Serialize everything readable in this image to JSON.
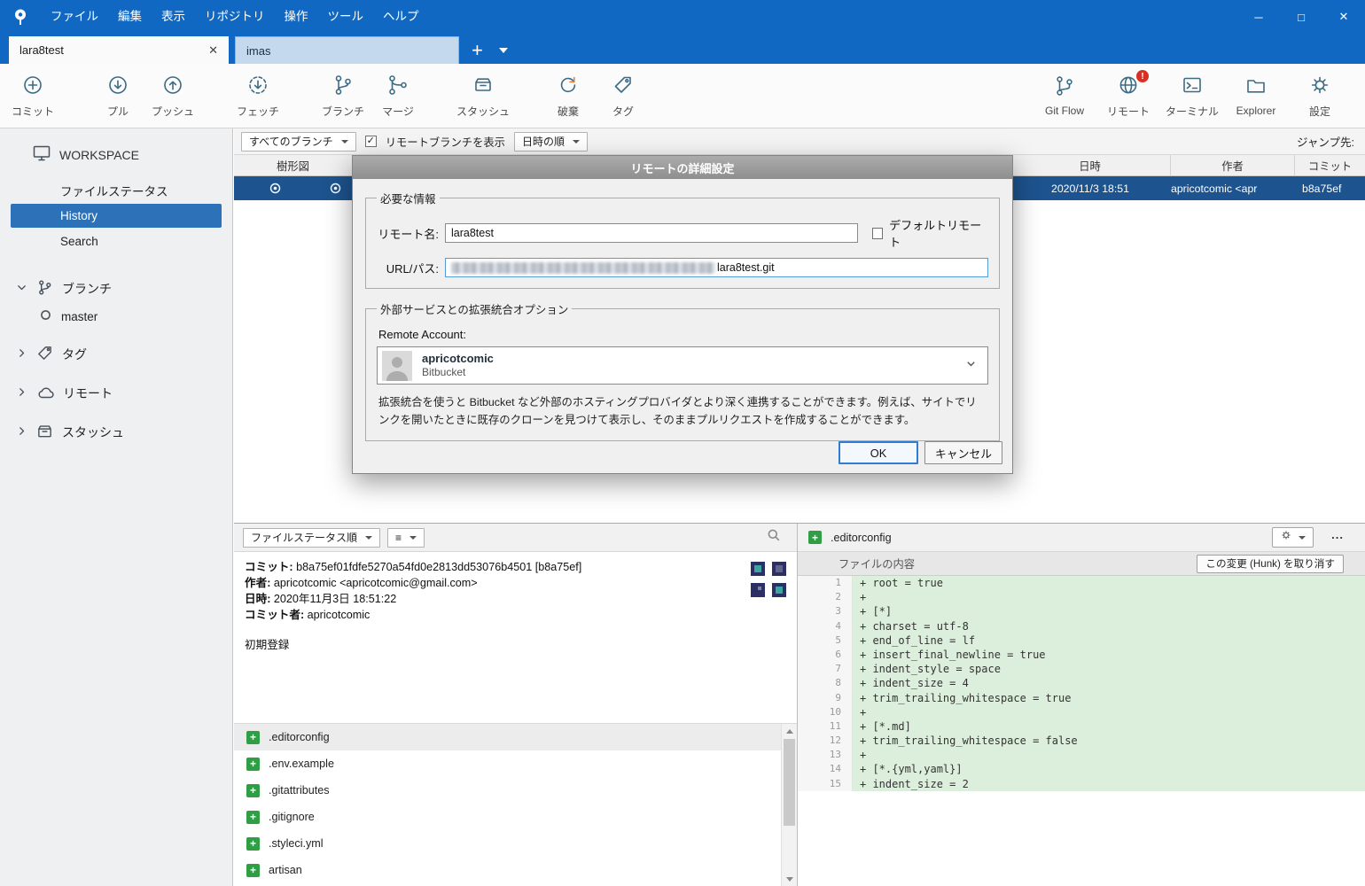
{
  "icons": {
    "minimize": "─",
    "maximize": "□",
    "close": "✕",
    "tab_close": "✕",
    "new_tab": "+",
    "check": "✓",
    "plus": "+",
    "list": "≡",
    "more": "..."
  },
  "window": {
    "menu": [
      "ファイル",
      "編集",
      "表示",
      "リポジトリ",
      "操作",
      "ツール",
      "ヘルプ"
    ],
    "tabs": [
      {
        "label": "lara8test"
      },
      {
        "label": "imas"
      }
    ]
  },
  "toolbar": {
    "left": [
      {
        "label": "コミット"
      },
      {
        "label": "プル"
      },
      {
        "label": "プッシュ"
      },
      {
        "label": "フェッチ"
      },
      {
        "label": "ブランチ"
      },
      {
        "label": "マージ"
      },
      {
        "label": "スタッシュ"
      },
      {
        "label": "破棄"
      },
      {
        "label": "タグ"
      }
    ],
    "right": [
      {
        "label": "Git Flow"
      },
      {
        "label": "リモート",
        "badge": "!"
      },
      {
        "label": "ターミナル"
      },
      {
        "label": "Explorer"
      },
      {
        "label": "設定"
      }
    ]
  },
  "sidebar": {
    "workspace": {
      "label": "WORKSPACE",
      "items": [
        "ファイルステータス",
        "History",
        "Search"
      ]
    },
    "sections": [
      {
        "label": "ブランチ",
        "items": [
          "master"
        ]
      },
      {
        "label": "タグ"
      },
      {
        "label": "リモート"
      },
      {
        "label": "スタッシュ"
      }
    ]
  },
  "history": {
    "branch_filter": "すべてのブランチ",
    "remote_checkbox": "リモートブランチを表示",
    "sort_filter": "日時の順",
    "jump_label": "ジャンプ先:",
    "columns": [
      "樹形図",
      "日時",
      "作者",
      "コミット"
    ],
    "selected": {
      "date": "2020/11/3 18:51",
      "author": "apricotcomic <apr",
      "commit": "b8a75ef"
    }
  },
  "dialog": {
    "title": "リモートの詳細設定",
    "required_group": "必要な情報",
    "remote_name_label": "リモート名:",
    "remote_name_value": "lara8test",
    "default_remote_label": "デフォルトリモート",
    "url_label": "URL/パス:",
    "url_visible_suffix": "lara8test.git",
    "integration_group": "外部サービスとの拡張統合オプション",
    "remote_account_label": "Remote Account:",
    "account_name": "apricotcomic",
    "account_service": "Bitbucket",
    "description": "拡張統合を使うと Bitbucket など外部のホスティングプロバイダとより深く連携することができます。例えば、サイトでリンクを開いたときに既存のクローンを見つけて表示し、そのままプルリクエストを作成することができます。",
    "ok_label": "OK",
    "cancel_label": "キャンセル"
  },
  "detail": {
    "sort_filter": "ファイルステータス順",
    "commit_label": "コミット:",
    "commit_value": "b8a75ef01fdfe5270a54fd0e2813dd53076b4501 [b8a75ef]",
    "author_label": "作者:",
    "author_value": "apricotcomic <apricotcomic@gmail.com>",
    "date_label": "日時:",
    "date_value": "2020年11月3日 18:51:22",
    "committer_label": "コミット者:",
    "committer_value": "apricotcomic",
    "message": "初期登録"
  },
  "files": {
    "items": [
      ".editorconfig",
      ".env.example",
      ".gitattributes",
      ".gitignore",
      ".styleci.yml",
      "artisan"
    ]
  },
  "diff": {
    "file": ".editorconfig",
    "panel_header": "ファイルの内容",
    "undo_hunk": "この変更 (Hunk) を取り消す",
    "lines": [
      {
        "n": "1",
        "t": "+ root = true"
      },
      {
        "n": "2",
        "t": "+"
      },
      {
        "n": "3",
        "t": "+ [*]"
      },
      {
        "n": "4",
        "t": "+ charset = utf-8"
      },
      {
        "n": "5",
        "t": "+ end_of_line = lf"
      },
      {
        "n": "6",
        "t": "+ insert_final_newline = true"
      },
      {
        "n": "7",
        "t": "+ indent_style = space"
      },
      {
        "n": "8",
        "t": "+ indent_size = 4"
      },
      {
        "n": "9",
        "t": "+ trim_trailing_whitespace = true"
      },
      {
        "n": "10",
        "t": "+"
      },
      {
        "n": "11",
        "t": "+ [*.md]"
      },
      {
        "n": "12",
        "t": "+ trim_trailing_whitespace = false"
      },
      {
        "n": "13",
        "t": "+"
      },
      {
        "n": "14",
        "t": "+ [*.{yml,yaml}]"
      },
      {
        "n": "15",
        "t": "+ indent_size = 2"
      }
    ]
  }
}
